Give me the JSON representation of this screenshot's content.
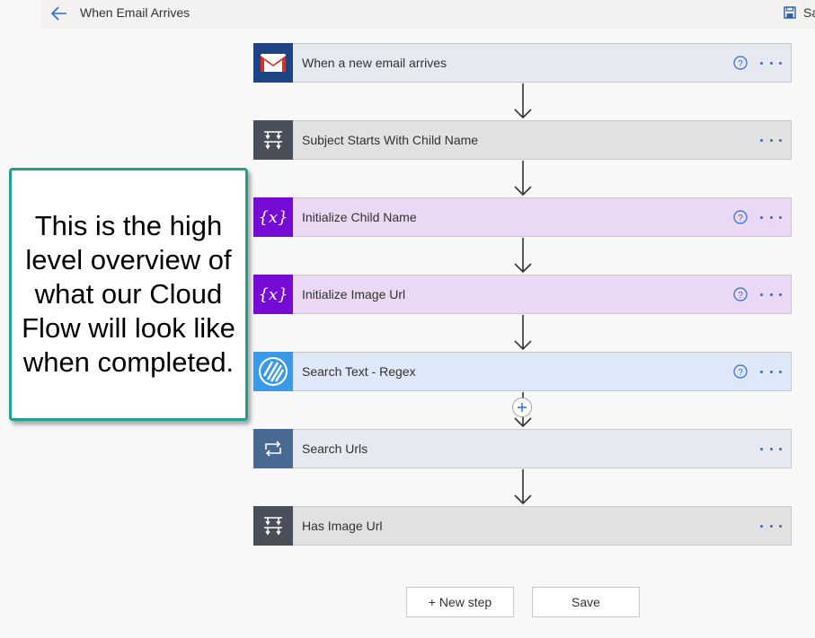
{
  "header": {
    "title": "When Email Arrives",
    "save_label": "Sa"
  },
  "steps": [
    {
      "label": "When a new email arrives",
      "icon": "gmail-icon",
      "help": true
    },
    {
      "label": "Subject Starts With Child Name",
      "icon": "condition-icon",
      "help": false
    },
    {
      "label": "Initialize Child Name",
      "icon": "variable-icon",
      "help": true
    },
    {
      "label": "Initialize Image Url",
      "icon": "variable-icon",
      "help": true
    },
    {
      "label": "Search Text - Regex",
      "icon": "regex-icon",
      "help": true
    },
    {
      "label": "Search Urls",
      "icon": "loop-icon",
      "help": false
    },
    {
      "label": "Has Image Url",
      "icon": "condition-icon",
      "help": false
    }
  ],
  "footer": {
    "new_step_label": "+ New step",
    "save_label": "Save"
  },
  "callout": {
    "text": "This is the high level overview of what our Cloud Flow will look like when completed."
  },
  "colors": {
    "gmail_bg": "#1f4486",
    "condition_bg": "#484f58",
    "variable_bg": "#770bd6",
    "regex_bg": "#3b9ae8",
    "loop_bg": "#486991",
    "accent": "#2b6ad8",
    "callout_border": "#1fa18c"
  }
}
